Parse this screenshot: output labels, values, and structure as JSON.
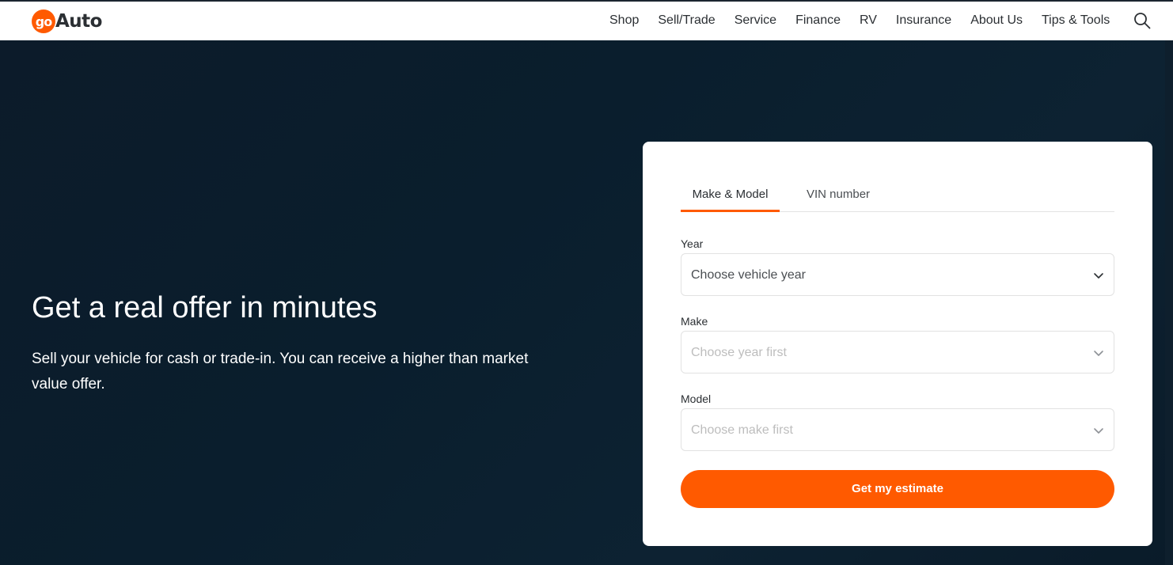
{
  "brand": {
    "logo_badge": "go",
    "logo_text": "Auto",
    "accent_color": "#ff5a00"
  },
  "nav": {
    "items": [
      "Shop",
      "Sell/Trade",
      "Service",
      "Finance",
      "RV",
      "Insurance",
      "About Us",
      "Tips & Tools"
    ],
    "search_icon": "search-icon"
  },
  "hero": {
    "headline": "Get a real offer in minutes",
    "subtext": "Sell your vehicle for cash or trade-in. You can receive a higher than market value offer."
  },
  "form": {
    "tabs": [
      "Make & Model",
      "VIN number"
    ],
    "active_tab": "Make & Model",
    "fields": [
      {
        "label": "Year",
        "placeholder": "Choose vehicle year",
        "disabled": false
      },
      {
        "label": "Make",
        "placeholder": "Choose year first",
        "disabled": true
      },
      {
        "label": "Model",
        "placeholder": "Choose make first",
        "disabled": true
      }
    ],
    "submit_label": "Get my estimate"
  }
}
